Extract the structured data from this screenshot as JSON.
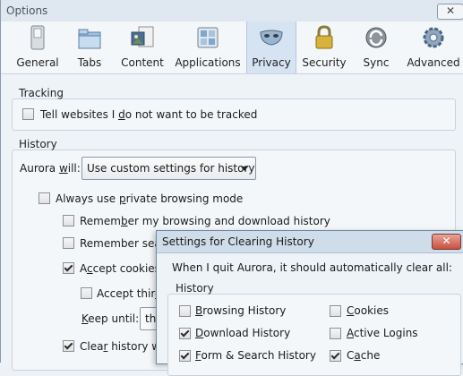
{
  "window": {
    "title": "Options",
    "close_symbol": "✕"
  },
  "toolbar": {
    "panes": [
      {
        "label": "General",
        "icon": "switch-icon"
      },
      {
        "label": "Tabs",
        "icon": "folders-icon"
      },
      {
        "label": "Content",
        "icon": "content-icon"
      },
      {
        "label": "Applications",
        "icon": "applications-icon"
      },
      {
        "label": "Privacy",
        "icon": "mask-icon",
        "selected": true
      },
      {
        "label": "Security",
        "icon": "padlock-icon"
      },
      {
        "label": "Sync",
        "icon": "sync-icon"
      },
      {
        "label": "Advanced",
        "icon": "gear-icon"
      }
    ]
  },
  "tracking": {
    "caption": "Tracking",
    "dnt_pre": "Tell websites I ",
    "dnt_key": "d",
    "dnt_post": "o not want to be tracked",
    "dnt_checked": false
  },
  "history": {
    "caption": "History",
    "will_pre": "Aurora ",
    "will_key": "w",
    "will_post": "ill:",
    "mode_value": "Use custom settings for history",
    "private_pre": "Always use ",
    "private_key": "p",
    "private_post": "rivate browsing mode",
    "private_checked": false,
    "remember_browsing_pre": "Remem",
    "remember_browsing_key": "b",
    "remember_browsing_post": "er my browsing and download history",
    "remember_browsing_checked": false,
    "remember_search_pre": "Remember searc",
    "remember_search_checked": false,
    "accept_cookies_pre": "A",
    "accept_cookies_key": "c",
    "accept_cookies_post": "cept cookies f",
    "accept_cookies_checked": true,
    "accept_third_pre": "Accept thir",
    "accept_third_key": "d",
    "accept_third_post": "-",
    "accept_third_checked": false,
    "keep_until_pre": "",
    "keep_until_key": "K",
    "keep_until_post": "eep until:",
    "keep_until_value": "the",
    "clear_history_pre": "Clea",
    "clear_history_key": "r",
    "clear_history_post": " history wh",
    "clear_history_checked": true
  },
  "dialog": {
    "title": "Settings for Clearing History",
    "close_symbol": "✕",
    "intro": "When I quit Aurora, it should automatically clear all:",
    "group_caption": "History",
    "items_left": [
      {
        "pre": "",
        "key": "B",
        "post": "rowsing History",
        "checked": false
      },
      {
        "pre": "",
        "key": "D",
        "post": "ownload History",
        "checked": true
      },
      {
        "pre": "",
        "key": "F",
        "post": "orm & Search History",
        "checked": true
      }
    ],
    "items_right": [
      {
        "pre": "",
        "key": "C",
        "post": "ookies",
        "checked": false
      },
      {
        "pre": "",
        "key": "A",
        "post": "ctive Logins",
        "checked": false
      },
      {
        "pre": "C",
        "key": "a",
        "post": "che",
        "checked": true
      }
    ]
  }
}
